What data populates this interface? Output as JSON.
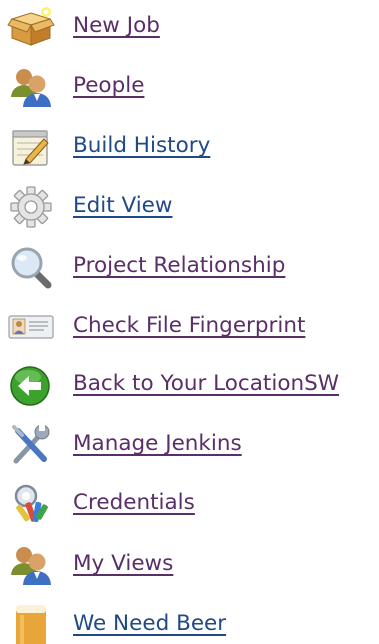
{
  "tasks": [
    {
      "label": "New Job",
      "icon": "new-package-icon",
      "state": "visited"
    },
    {
      "label": "People",
      "icon": "people-icon",
      "state": "visited"
    },
    {
      "label": "Build History",
      "icon": "notepad-icon",
      "state": "unvisited"
    },
    {
      "label": "Edit View",
      "icon": "gear-icon",
      "state": "unvisited"
    },
    {
      "label": "Project Relationship",
      "icon": "magnifier-icon",
      "state": "visited"
    },
    {
      "label": "Check File Fingerprint",
      "icon": "fingerprint-card-icon",
      "state": "visited"
    },
    {
      "label": "Back to Your LocationSW",
      "icon": "back-arrow-icon",
      "state": "visited"
    },
    {
      "label": "Manage Jenkins",
      "icon": "tools-icon",
      "state": "visited"
    },
    {
      "label": "Credentials",
      "icon": "keys-icon",
      "state": "visited"
    },
    {
      "label": "My Views",
      "icon": "people-icon",
      "state": "visited"
    },
    {
      "label": "We Need Beer",
      "icon": "beer-icon",
      "state": "unvisited"
    }
  ],
  "colors": {
    "visited_link": "#5a2f68",
    "unvisited_link": "#204a87"
  }
}
